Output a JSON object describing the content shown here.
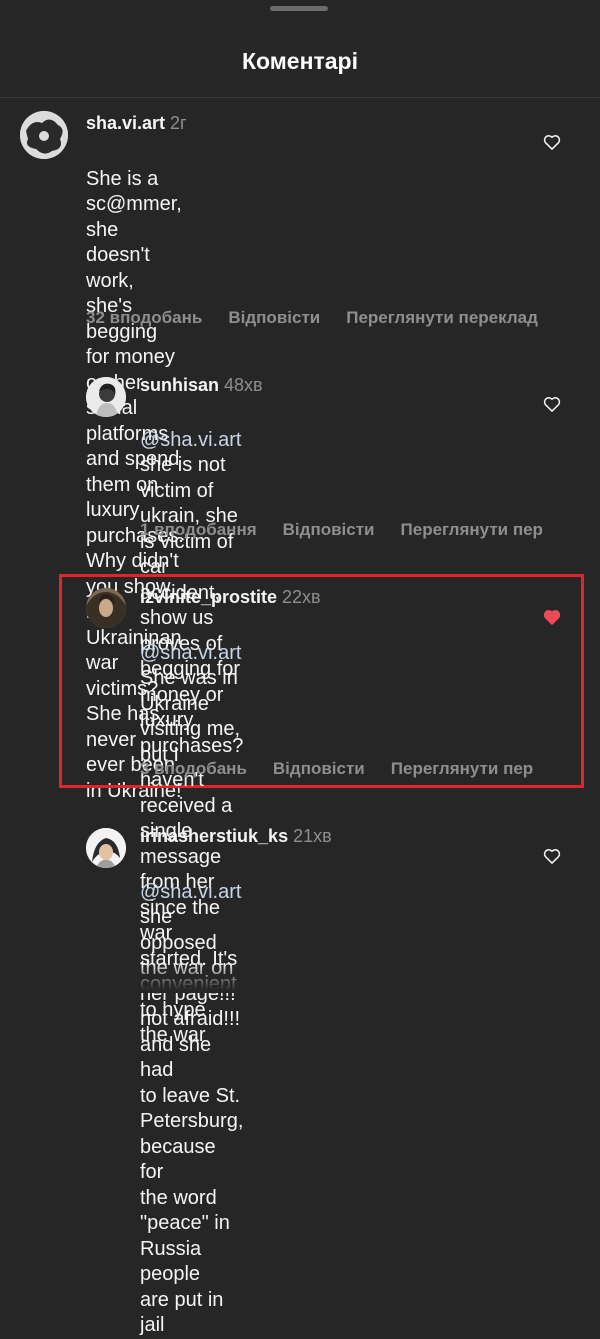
{
  "header": {
    "title": "Коментарі"
  },
  "comments": [
    {
      "username": "sha.vi.art",
      "time": "2г",
      "mention": "",
      "text": "She is a sc@mmer, she doesn't work,\nshe's begging for money on her social\nplatforms and spend them on luxury\npurchases. Why didn't you show real\nUkraininan war victims? She has never\never been in Ukraine!",
      "likes": "32 вподобань",
      "reply": "Відповісти",
      "translate": "Переглянути переклад",
      "liked": false
    },
    {
      "username": "sunhisan",
      "time": "48хв",
      "mention": "@sha.vi.art",
      "text": " she is not victim of\nukrain, she is victim of car accident,\nshow us proves of begging for\nmoney or luxury purchases?",
      "likes": "1 вподобання",
      "reply": "Відповісти",
      "translate": "Переглянути пер",
      "liked": false
    },
    {
      "username": "izvinite_prostite",
      "time": "22хв",
      "mention": "@sha.vi.art",
      "text": " She was in Ukraine\nvisiting me, but I haven't received a\nsingle message from her since the\nwar started. It's convenient to hype\nthe war",
      "likes": "3 вподобань",
      "reply": "Відповісти",
      "translate": "Переглянути пер",
      "liked": true
    },
    {
      "username": "irinasherstiuk_ks",
      "time": "21хв",
      "mention": "@sha.vi.art",
      "text": " she opposed the war on\nher page!!! not afraid!!! and she had\nto leave St. Petersburg, because for\nthe word \"peace\" in Russia people\nare put in jail",
      "likes": "",
      "reply": "",
      "translate": "",
      "liked": false
    }
  ],
  "icons": {
    "heart_outline": "heart-outline-icon",
    "heart_filled": "heart-filled-icon",
    "liked_color": "#ed4956"
  },
  "annotation": {
    "highlight_color": "#e0262b"
  }
}
